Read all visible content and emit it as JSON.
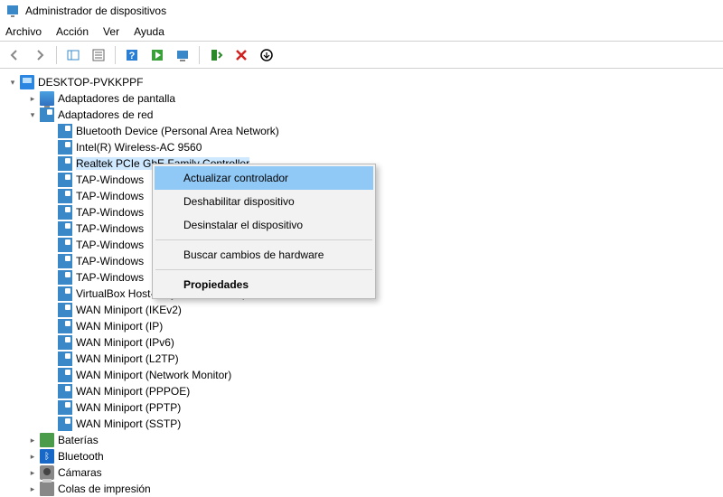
{
  "window": {
    "title": "Administrador de dispositivos"
  },
  "menu": {
    "file": "Archivo",
    "action": "Acción",
    "view": "Ver",
    "help": "Ayuda"
  },
  "tree": {
    "root": "DESKTOP-PVKKPPF",
    "display_adapters": "Adaptadores de pantalla",
    "network_adapters": "Adaptadores de red",
    "net_items": {
      "bt_pan": "Bluetooth Device (Personal Area Network)",
      "intel_wifi": "Intel(R) Wireless-AC 9560",
      "realtek": "Realtek PCIe GbE Family Controller",
      "tap": "TAP-Windows",
      "vbox": "VirtualBox Host-Only Ethernet Adapter",
      "wan_ikev2": "WAN Miniport (IKEv2)",
      "wan_ip": "WAN Miniport (IP)",
      "wan_ipv6": "WAN Miniport (IPv6)",
      "wan_l2tp": "WAN Miniport (L2TP)",
      "wan_netmon": "WAN Miniport (Network Monitor)",
      "wan_pppoe": "WAN Miniport (PPPOE)",
      "wan_pptp": "WAN Miniport (PPTP)",
      "wan_sstp": "WAN Miniport (SSTP)"
    },
    "batteries": "Baterías",
    "bluetooth": "Bluetooth",
    "cameras": "Cámaras",
    "print_queues": "Colas de impresión"
  },
  "context_menu": {
    "update_driver": "Actualizar controlador",
    "disable_device": "Deshabilitar dispositivo",
    "uninstall_device": "Desinstalar el dispositivo",
    "scan_hardware": "Buscar cambios de hardware",
    "properties": "Propiedades"
  }
}
